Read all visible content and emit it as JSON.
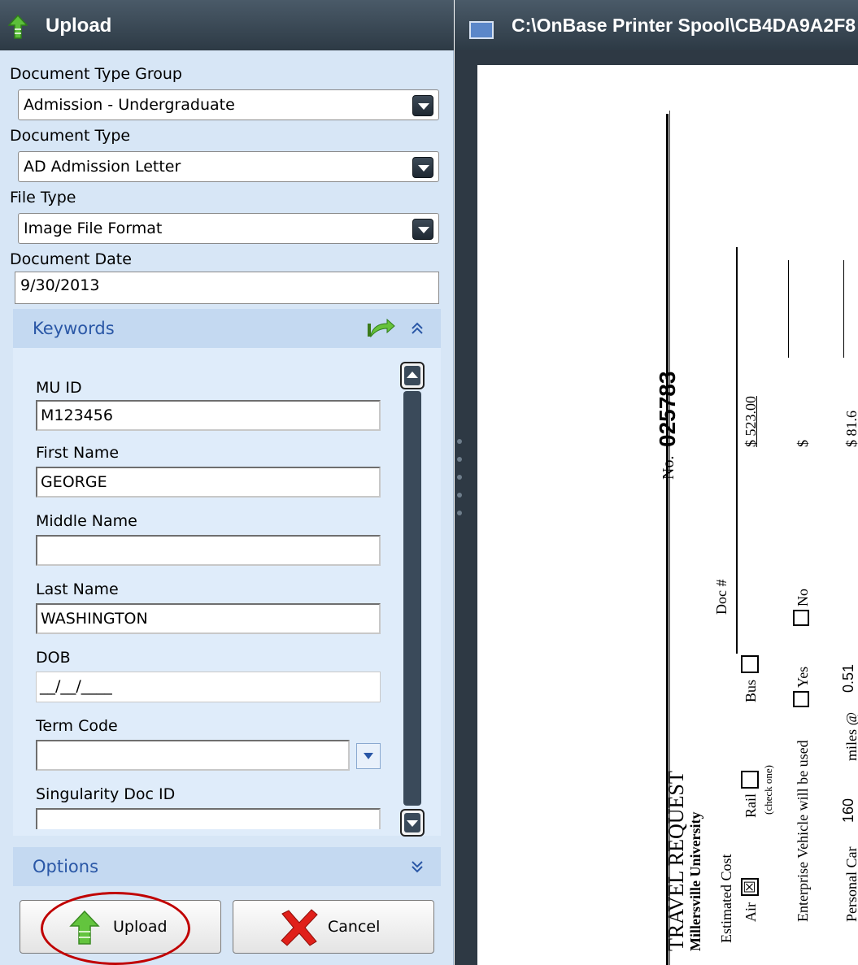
{
  "left_panel": {
    "title": "Upload",
    "fields": {
      "doc_type_group": {
        "label": "Document Type Group",
        "value": "Admission - Undergraduate"
      },
      "doc_type": {
        "label": "Document Type",
        "value": "AD Admission Letter"
      },
      "file_type": {
        "label": "File Type",
        "value": "Image File Format"
      },
      "doc_date": {
        "label": "Document Date",
        "value": "9/30/2013"
      }
    },
    "keywords": {
      "title": "Keywords",
      "items": [
        {
          "label": "MU ID",
          "value": "M123456"
        },
        {
          "label": "First Name",
          "value": "GEORGE"
        },
        {
          "label": "Middle Name",
          "value": ""
        },
        {
          "label": "Last Name",
          "value": "WASHINGTON"
        },
        {
          "label": "DOB",
          "value": "__/__/____"
        },
        {
          "label": "Term Code",
          "value": ""
        },
        {
          "label": "Singularity Doc ID",
          "value": ""
        }
      ]
    },
    "options": {
      "title": "Options"
    },
    "buttons": {
      "upload": "Upload",
      "cancel": "Cancel"
    }
  },
  "right_panel": {
    "title": "C:\\OnBase Printer Spool\\CB4DA9A2F8",
    "document": {
      "heading": "TRAVEL REQUEST",
      "subheading": "Millersville University",
      "number_prefix": "No.",
      "number": "025783",
      "doc_label": "Doc #",
      "estimated_cost": "Estimated Cost",
      "air": "Air",
      "rail": "Rail",
      "check_one": "(check one)",
      "bus": "Bus",
      "cost_1": "$ 523.00",
      "cost_2": "$",
      "cost_3": "$ 81.6",
      "enterprise": "Enterprise Vehicle will be used",
      "yes": "Yes",
      "no": "No",
      "personal_car": "Personal Car",
      "miles": "160",
      "miles_at": "miles @",
      "rate": "0.51"
    }
  }
}
